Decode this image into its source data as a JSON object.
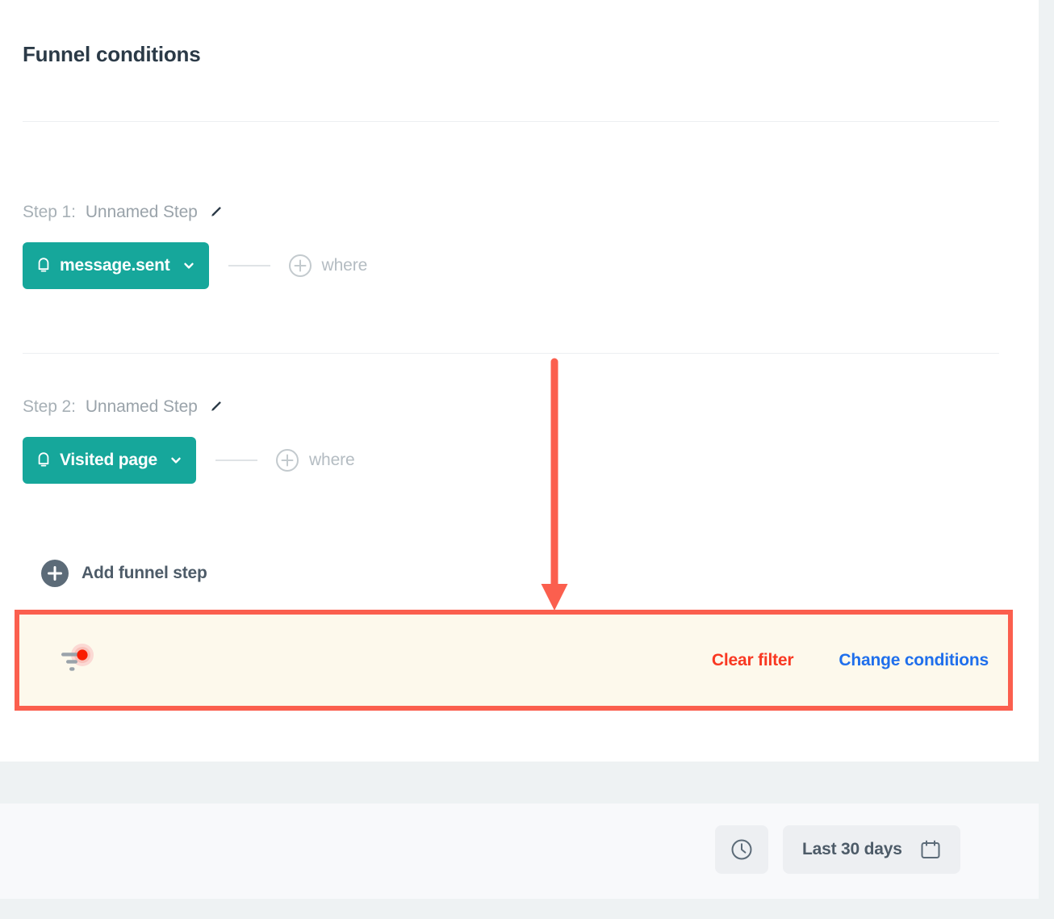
{
  "page": {
    "title": "Funnel conditions"
  },
  "steps": [
    {
      "label": "Step 1:",
      "name": "Unnamed Step",
      "edit_icon": "pencil-icon",
      "event": {
        "icon": "bell-icon",
        "label": "message.sent",
        "caret": "chevron-down-icon"
      },
      "where": {
        "icon": "plus-circle-icon",
        "label": "where"
      }
    },
    {
      "label": "Step 2:",
      "name": "Unnamed Step",
      "edit_icon": "pencil-icon",
      "event": {
        "icon": "bell-icon",
        "label": "Visited page",
        "caret": "chevron-down-icon"
      },
      "where": {
        "icon": "plus-circle-icon",
        "label": "where"
      }
    }
  ],
  "add_step": {
    "icon": "plus-filled-circle-icon",
    "label": "Add funnel step"
  },
  "filter_bar": {
    "icon": "filter-with-alert-dot-icon",
    "clear_label": "Clear filter",
    "change_label": "Change conditions"
  },
  "date_controls": {
    "clock_icon": "clock-icon",
    "range_label": "Last 30 days",
    "calendar_icon": "calendar-icon"
  },
  "colors": {
    "accent_teal": "#16a79b",
    "highlight_border": "#fb5f4e",
    "highlight_bg": "#fdf9ec",
    "clear_link": "#f93822",
    "change_link": "#1f6fec",
    "title_text": "#2b3a47",
    "muted_text": "#a7b0b6",
    "arrow": "#fb5f4e"
  }
}
